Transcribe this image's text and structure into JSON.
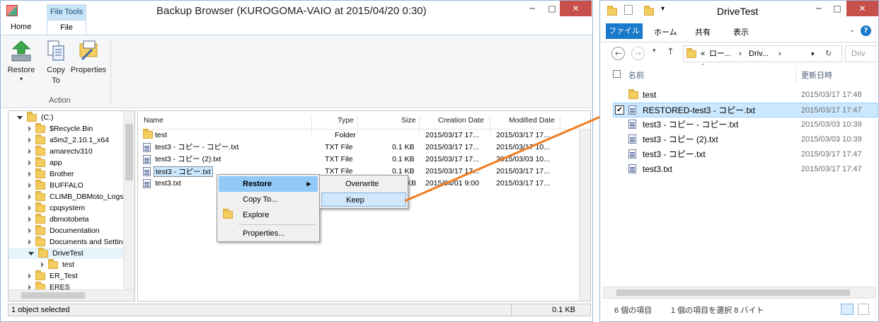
{
  "left_window": {
    "title": "Backup Browser (KUROGOMA-VAIO at 2015/04/20 0:30)",
    "controls": {
      "minimize": "─",
      "maximize": "□",
      "close": "✕"
    },
    "ribbon_context_label": "File Tools",
    "tabs": {
      "home": "Home",
      "file": "File"
    },
    "ribbon": {
      "restore_label": "Restore",
      "restore_arrow": "▾",
      "copy_line1": "Copy",
      "copy_line2": "To",
      "properties_label": "Properties",
      "group_label": "Action"
    },
    "tree": {
      "items": [
        {
          "label": "(C:)"
        },
        {
          "label": "$Recycle.Bin"
        },
        {
          "label": "a5m2_2.10.1_x64"
        },
        {
          "label": "amarectv310"
        },
        {
          "label": "app"
        },
        {
          "label": "Brother"
        },
        {
          "label": "BUFFALO"
        },
        {
          "label": "CLIMB_DBMoto_Logs"
        },
        {
          "label": "cpqsystem"
        },
        {
          "label": "dbmotobeta"
        },
        {
          "label": "Documentation"
        },
        {
          "label": "Documents and Settings"
        },
        {
          "label": "DriveTest"
        },
        {
          "label": "test"
        },
        {
          "label": "ER_Test"
        },
        {
          "label": "ERES"
        }
      ]
    },
    "list": {
      "columns": {
        "name": "Name",
        "type": "Type",
        "size": "Size",
        "created": "Creation Date",
        "modified": "Modified Date"
      },
      "rows": [
        {
          "name": "test",
          "type": "Folder",
          "size": "",
          "created": "2015/03/17 17...",
          "modified": "2015/03/17 17..."
        },
        {
          "name": "test3 - コピー - コピー.txt",
          "type": "TXT File",
          "size": "0.1 KB",
          "created": "2015/03/17 17...",
          "modified": "2015/03/17 10..."
        },
        {
          "name": "test3 - コピー (2).txt",
          "type": "TXT File",
          "size": "0.1 KB",
          "created": "2015/03/17 17...",
          "modified": "2015/03/03 10..."
        },
        {
          "name": "test3 - コピー.txt",
          "type": "TXT File",
          "size": "0.1 KB",
          "created": "2015/03/17 17...",
          "modified": "2015/03/17 17..."
        },
        {
          "name": "test3.txt",
          "type": "TXT File",
          "size": "KB",
          "created": "2015/04/01 9:00",
          "modified": "2015/03/17 17..."
        }
      ]
    },
    "context_menu": {
      "restore": "Restore",
      "restore_arrow": "▸",
      "copy_to": "Copy To...",
      "explore": "Explore",
      "properties": "Properties..."
    },
    "submenu": {
      "overwrite": "Overwrite",
      "keep": "Keep"
    },
    "status": {
      "selected": "1 object selected",
      "size": "0.1 KB"
    }
  },
  "right_window": {
    "title": "DriveTest",
    "controls": {
      "minimize": "─",
      "maximize": "□",
      "close": "✕"
    },
    "tabs": {
      "file": "ファイル",
      "home": "ホーム",
      "share": "共有",
      "view": "表示"
    },
    "address": {
      "prefix": "«",
      "part1": "ロー...",
      "sep": "›",
      "part2": "Driv...",
      "search_placeholder": "Driv"
    },
    "columns": {
      "name": "名前",
      "modified": "更新日時"
    },
    "rows": [
      {
        "name": "test",
        "date": "2015/03/17 17:48"
      },
      {
        "name": "RESTORED-test3 - コピー.txt",
        "date": "2015/03/17 17:47"
      },
      {
        "name": "test3 - コピー - コピー.txt",
        "date": "2015/03/03 10:39"
      },
      {
        "name": "test3 - コピー (2).txt",
        "date": "2015/03/03 10:39"
      },
      {
        "name": "test3 - コピー.txt",
        "date": "2015/03/17 17:47"
      },
      {
        "name": "test3.txt",
        "date": "2015/03/17 17:47"
      }
    ],
    "status": {
      "count": "6 個の項目",
      "selected": "1 個の項目を選択 8 バイト"
    }
  },
  "colors": {
    "accent": "#1979ca",
    "selection": "#cce8ff",
    "menu_highlight": "#91c9f7",
    "arrow": "#f07d22",
    "close_button": "#c7504a"
  }
}
